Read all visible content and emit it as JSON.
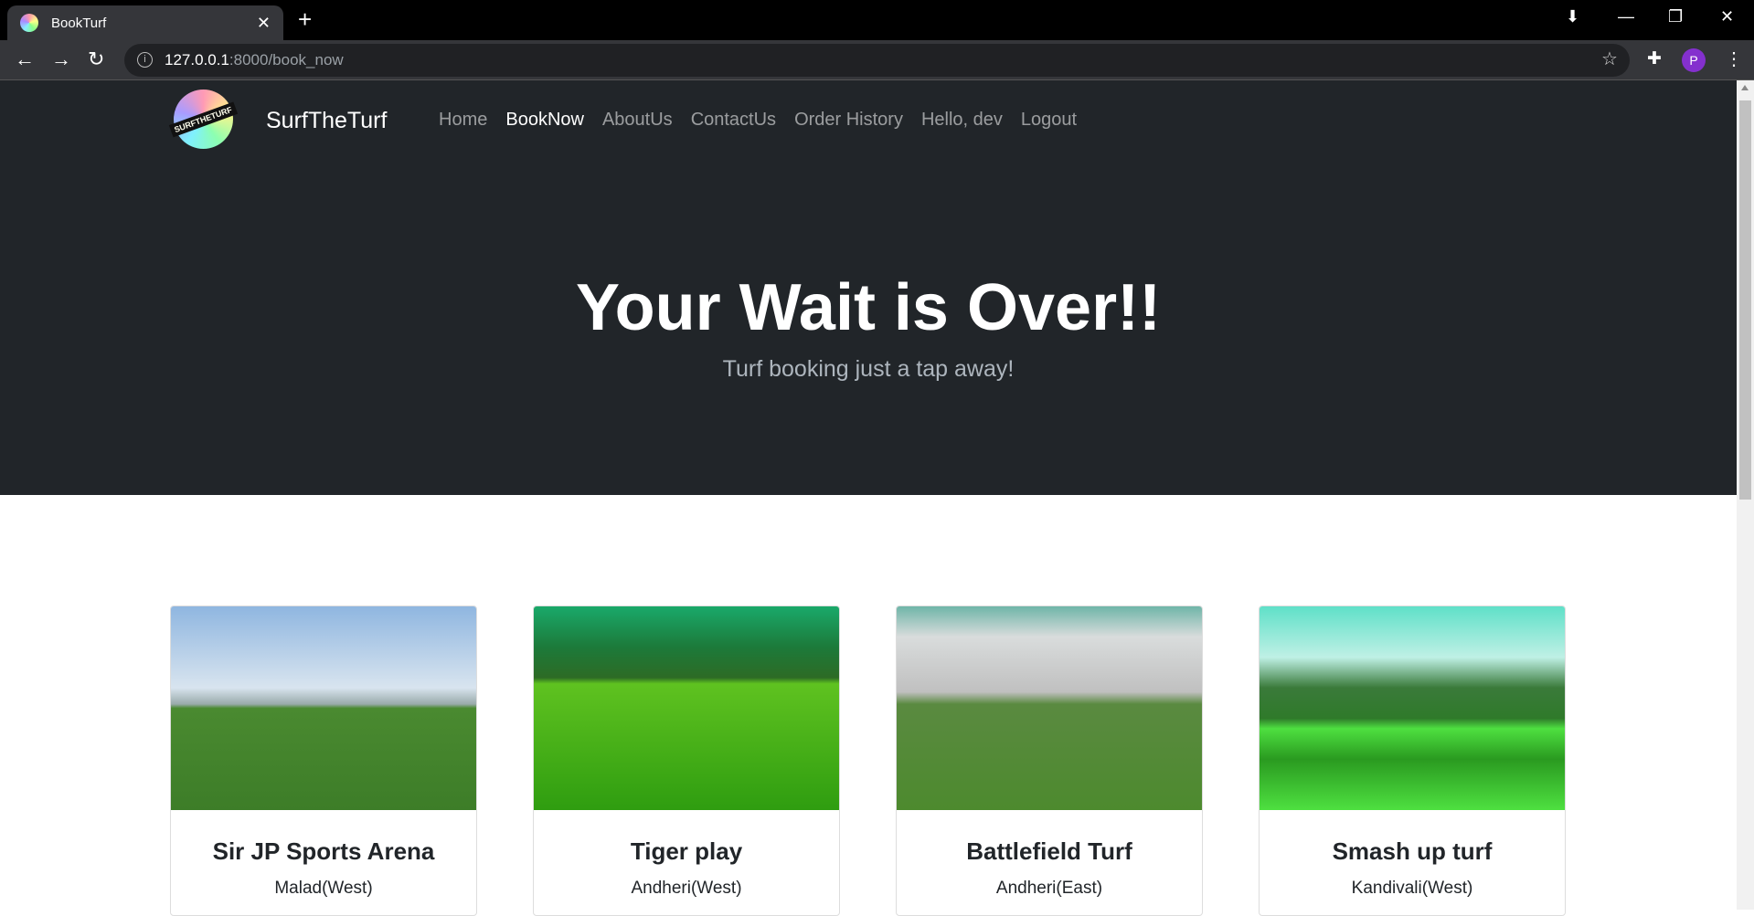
{
  "browser": {
    "tab_title": "BookTurf",
    "url_host": "127.0.0.1",
    "url_rest": ":8000/book_now",
    "profile_initial": "P"
  },
  "navbar": {
    "brand": "SurfTheTurf",
    "logo_text": "SURFTHETURF",
    "links": [
      {
        "label": "Home"
      },
      {
        "label": "BookNow",
        "active": true
      },
      {
        "label": "AboutUs"
      },
      {
        "label": "ContactUs"
      },
      {
        "label": "Order History"
      },
      {
        "label": "Hello, dev"
      },
      {
        "label": "Logout"
      }
    ]
  },
  "hero": {
    "title": "Your Wait is Over!!",
    "subtitle": "Turf booking just a tap away!"
  },
  "turfs": [
    {
      "name": "Sir JP Sports Arena",
      "location": "Malad(West)"
    },
    {
      "name": "Tiger play",
      "location": "Andheri(West)"
    },
    {
      "name": "Battlefield Turf",
      "location": "Andheri(East)"
    },
    {
      "name": "Smash up turf",
      "location": "Kandivali(West)"
    }
  ],
  "colors": {
    "navbar_bg": "#212529",
    "accent_profile": "#8430ce"
  }
}
